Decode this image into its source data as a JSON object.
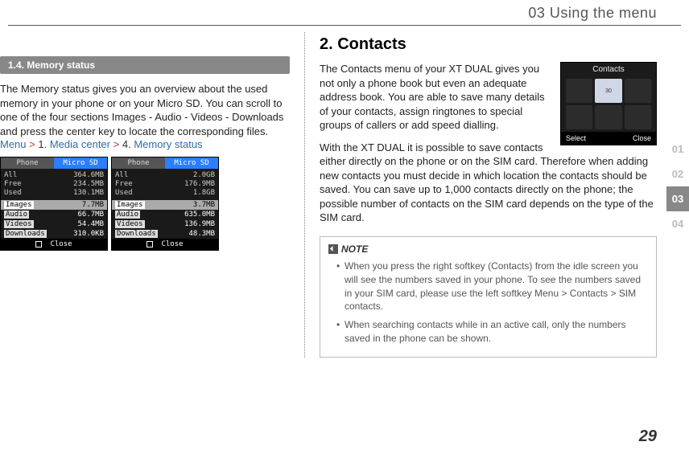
{
  "header": {
    "chapter": "03 Using the menu"
  },
  "left": {
    "section_title": "1.4. Memory status",
    "body": "The Memory status gives you an overview about the used memory in your phone or on your Micro SD. You can scroll to one of the four sections Images - Audio - Videos - Downloads and press the center key to locate the corresponding files.",
    "nav": {
      "menu": "Menu",
      "gt1": ">",
      "step1": "1.",
      "media": "Media center",
      "gt2": ">",
      "step4": "4.",
      "memstat": "Memory status"
    },
    "screens": [
      {
        "tabs": [
          "Phone",
          "Micro SD"
        ],
        "active_tab": 0,
        "stats": [
          [
            "All",
            "364.6MB"
          ],
          [
            "Free",
            "234.5MB"
          ],
          [
            "Used",
            "130.1MB"
          ]
        ],
        "rows": [
          [
            "Images",
            "7.7MB"
          ],
          [
            "Audio",
            "66.7MB"
          ],
          [
            "Videos",
            "54.4MB"
          ],
          [
            "Downloads",
            "310.0KB"
          ]
        ],
        "soft": "Close"
      },
      {
        "tabs": [
          "Phone",
          "Micro SD"
        ],
        "active_tab": 1,
        "stats": [
          [
            "All",
            "2.0GB"
          ],
          [
            "Free",
            "176.9MB"
          ],
          [
            "Used",
            "1.8GB"
          ]
        ],
        "rows": [
          [
            "Images",
            "3.7MB"
          ],
          [
            "Audio",
            "635.0MB"
          ],
          [
            "Videos",
            "136.9MB"
          ],
          [
            "Downloads",
            "48.3MB"
          ]
        ],
        "soft": "Close"
      }
    ]
  },
  "right": {
    "heading": "2. Contacts",
    "para1": "The Contacts menu of your XT DUAL gives you not only a phone book but even an adequate address book. You are able to save many details of your contacts, assign ringtones to special groups of callers or add speed dialling.",
    "para2": "With the XT DUAL it is possible to save contacts either directly on the phone or on the SIM card. Therefore when adding new contacts you must decide in which location the contacts should be saved. You can save up to 1,000 contacts directly on the phone; the possible number of contacts on the SIM card depends on the type of the SIM card.",
    "thumb": {
      "title": "Contacts",
      "select": "Select",
      "close": "Close"
    },
    "note": {
      "label": "NOTE",
      "items": [
        "When you press the right softkey (Contacts) from the idle screen you will see the numbers saved in your phone. To see the numbers saved in your SIM card, please use the left softkey Menu > Contacts > SIM contacts.",
        "When searching contacts while in an active call, only the numbers saved in the phone can be shown."
      ]
    }
  },
  "side": {
    "tabs": [
      "01",
      "02",
      "03",
      "04"
    ],
    "active": 2
  },
  "page": "29"
}
